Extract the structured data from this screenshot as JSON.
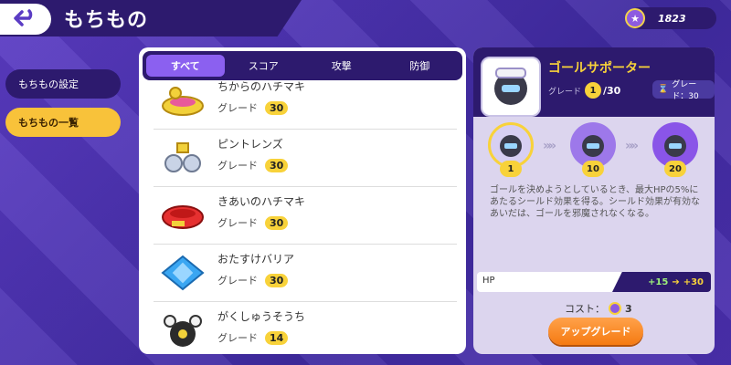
{
  "header": {
    "title": "もちもの",
    "coins": "1823"
  },
  "sidebar": {
    "items": [
      {
        "label": "もちもの設定"
      },
      {
        "label": "もちもの一覧"
      }
    ]
  },
  "tabs": [
    {
      "label": "すべて"
    },
    {
      "label": "スコア"
    },
    {
      "label": "攻撃"
    },
    {
      "label": "防御"
    }
  ],
  "items": [
    {
      "name": "ちからのハチマキ",
      "grade_label": "グレード",
      "grade": "30"
    },
    {
      "name": "ピントレンズ",
      "grade_label": "グレード",
      "grade": "30"
    },
    {
      "name": "きあいのハチマキ",
      "grade_label": "グレード",
      "grade": "30"
    },
    {
      "name": "おたすけバリア",
      "grade_label": "グレード",
      "grade": "30"
    },
    {
      "name": "がくしゅうそうち",
      "grade_label": "グレード",
      "grade": "14"
    }
  ],
  "detail": {
    "name": "ゴールサポーター",
    "grade_label": "グレード",
    "grade": "1",
    "grade_max": "/30",
    "grade_chip": "グレード：30",
    "tiers": [
      "1",
      "10",
      "20"
    ],
    "description": "ゴールを決めようとしているとき、最大HPの5%にあたるシールド効果を得る。シールド効果が有効なあいだは、ゴールを邪魔されなくなる。",
    "stat_label": "HP",
    "stat_from": "+15",
    "stat_to": "+30",
    "cost_label": "コスト：",
    "cost_value": "3",
    "upgrade_label": "アップグレード"
  }
}
